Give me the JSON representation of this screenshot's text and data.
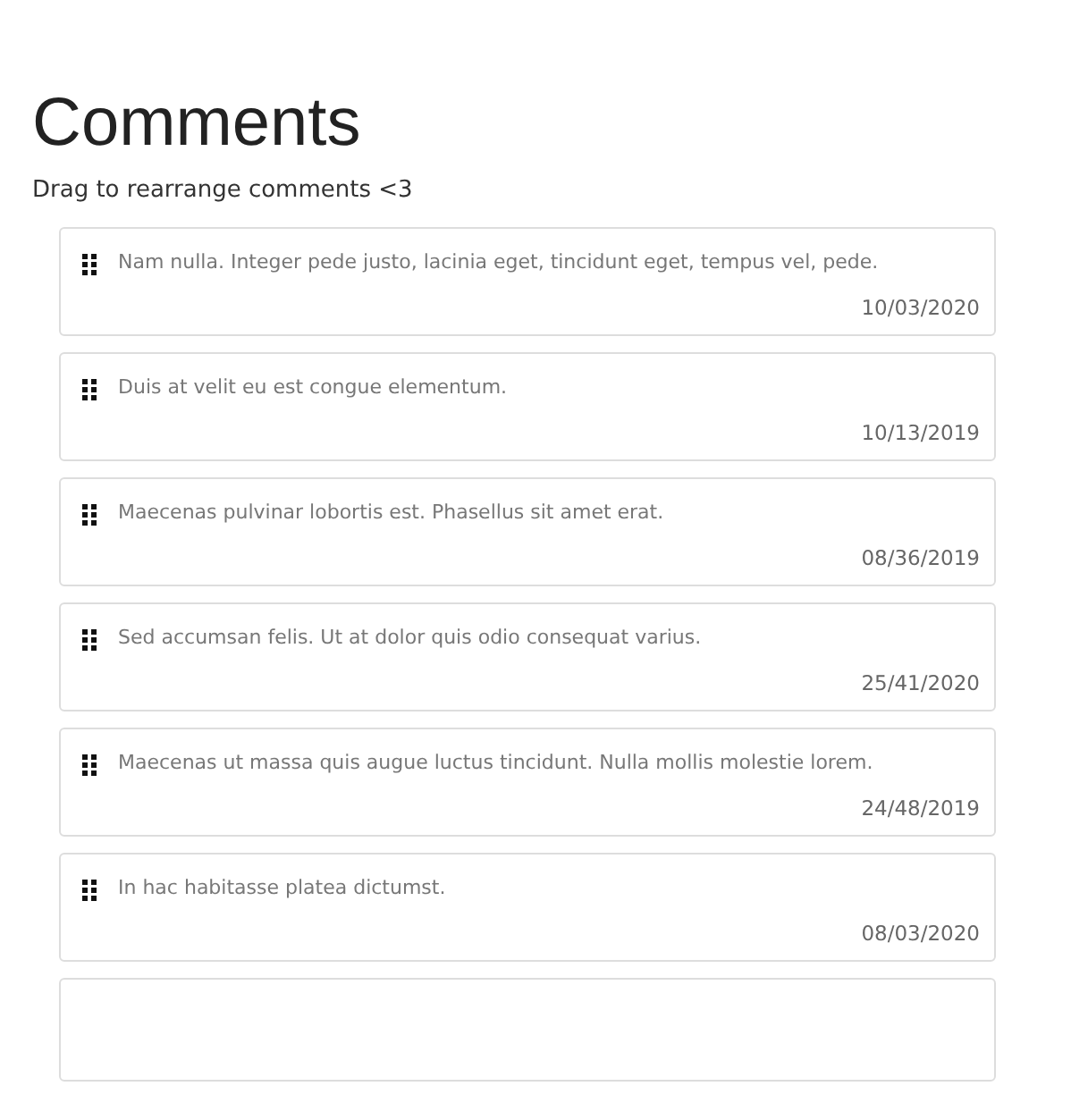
{
  "title": "Comments",
  "subtitle": "Drag to rearrange comments <3",
  "comments": [
    {
      "text": "Nam nulla. Integer pede justo, lacinia eget, tincidunt eget, tempus vel, pede.",
      "date": "10/03/2020"
    },
    {
      "text": "Duis at velit eu est congue elementum.",
      "date": "10/13/2019"
    },
    {
      "text": "Maecenas pulvinar lobortis est. Phasellus sit amet erat.",
      "date": "08/36/2019"
    },
    {
      "text": "Sed accumsan felis. Ut at dolor quis odio consequat varius.",
      "date": "25/41/2020"
    },
    {
      "text": "Maecenas ut massa quis augue luctus tincidunt. Nulla mollis molestie lorem.",
      "date": "24/48/2019"
    },
    {
      "text": "In hac habitasse platea dictumst.",
      "date": "08/03/2020"
    }
  ]
}
